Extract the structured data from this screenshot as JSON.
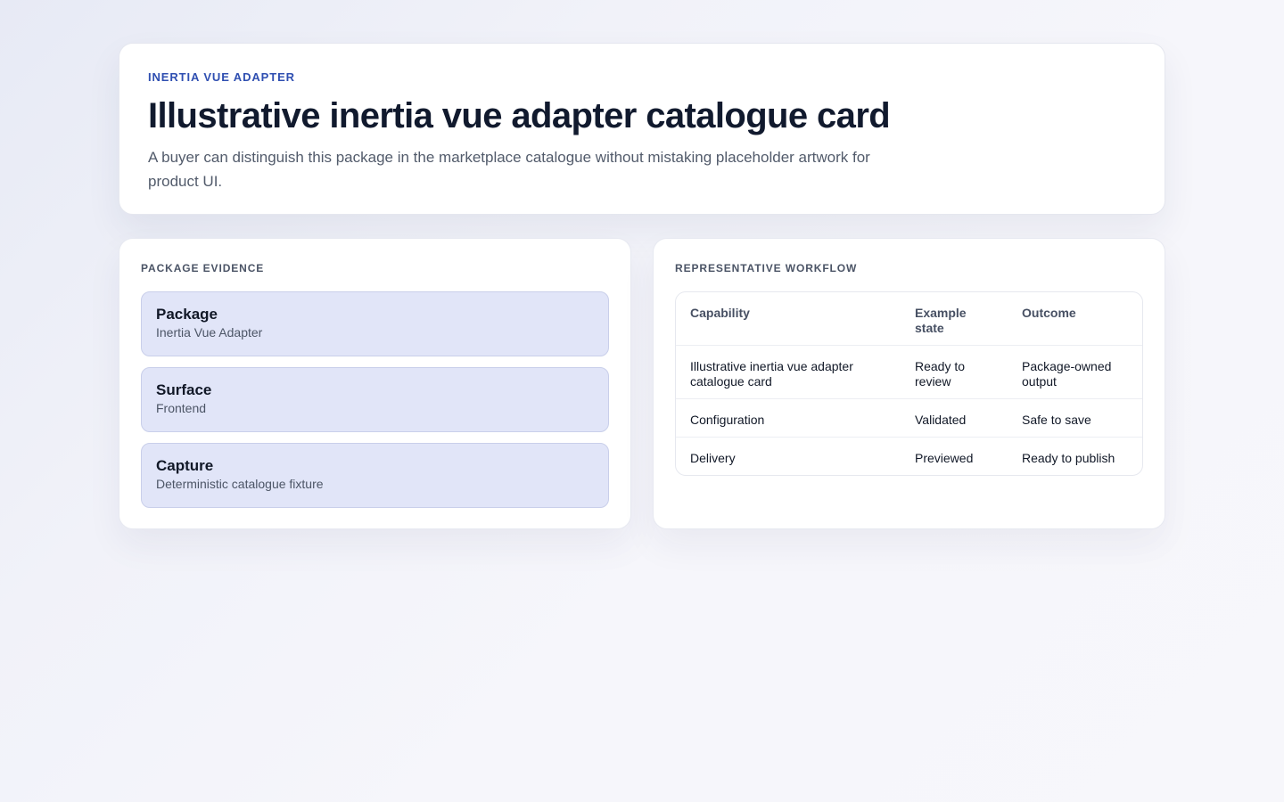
{
  "hero": {
    "eyebrow": "INERTIA VUE ADAPTER",
    "title": "Illustrative inertia vue adapter catalogue card",
    "subtitle": "A buyer can distinguish this package in the marketplace catalogue without mistaking placeholder artwork for product UI."
  },
  "evidence": {
    "heading": "PACKAGE EVIDENCE",
    "items": [
      {
        "label": "Package",
        "value": "Inertia Vue Adapter"
      },
      {
        "label": "Surface",
        "value": "Frontend"
      },
      {
        "label": "Capture",
        "value": "Deterministic catalogue fixture"
      }
    ]
  },
  "workflow": {
    "heading": "REPRESENTATIVE WORKFLOW",
    "columns": [
      "Capability",
      "Example state",
      "Outcome"
    ],
    "rows": [
      [
        "Illustrative inertia vue adapter catalogue card",
        "Ready to review",
        "Package-owned output"
      ],
      [
        "Configuration",
        "Validated",
        "Safe to save"
      ],
      [
        "Delivery",
        "Previewed",
        "Ready to publish"
      ]
    ]
  }
}
